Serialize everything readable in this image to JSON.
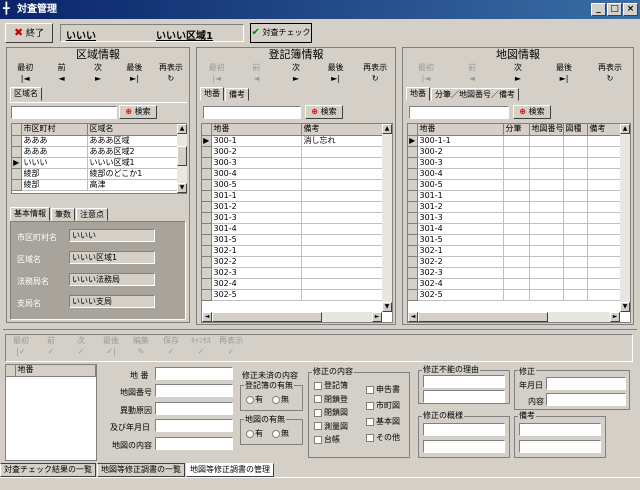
{
  "window": {
    "title": "対査管理",
    "minimize": "_",
    "maximize": "□",
    "close": "×"
  },
  "toolbar": {
    "exit_label": "終了",
    "area1": "いいい",
    "area2": "いいい区域1",
    "check_label": "対査チェック"
  },
  "nav": {
    "first": "最初",
    "prev": "前",
    "next": "次",
    "last": "最後",
    "refresh": "再表示",
    "edit": "編集",
    "save": "保存",
    "cancel": "ｷｬﾝｾﾙ"
  },
  "search": {
    "label": "検索"
  },
  "area_panel": {
    "title": "区域情報",
    "tab": "区域名",
    "columns": [
      "市区町村",
      "区域名"
    ],
    "rows": [
      [
        "あああ",
        "あああ区域"
      ],
      [
        "あああ",
        "あああ区域2"
      ],
      [
        "いいい",
        "いいい区域1"
      ],
      [
        "綾部",
        "綾部のどこか1"
      ],
      [
        "綾部",
        "高津"
      ]
    ],
    "current_row": 2,
    "info_tabs": [
      "基本情報",
      "筆数",
      "注意点"
    ],
    "info": {
      "city_label": "市区町村名",
      "city": "いいい",
      "area_label": "区域名",
      "area": "いいい区域1",
      "bureau_label": "法務局名",
      "bureau": "いいい法務局",
      "branch_label": "支局名",
      "branch": "いいい支局"
    }
  },
  "register_panel": {
    "title": "登記簿情報",
    "tabs": [
      "地番",
      "備考"
    ],
    "columns": [
      "地番",
      "備考"
    ],
    "rows": [
      [
        "300-1",
        "消し忘れ"
      ],
      [
        "300-2",
        ""
      ],
      [
        "300-3",
        ""
      ],
      [
        "300-4",
        ""
      ],
      [
        "300-5",
        ""
      ],
      [
        "301-1",
        ""
      ],
      [
        "301-2",
        ""
      ],
      [
        "301-3",
        ""
      ],
      [
        "301-4",
        ""
      ],
      [
        "301-5",
        ""
      ],
      [
        "302-1",
        ""
      ],
      [
        "302-2",
        ""
      ],
      [
        "302-3",
        ""
      ],
      [
        "302-4",
        ""
      ],
      [
        "302-5",
        ""
      ]
    ]
  },
  "map_panel": {
    "title": "地図情報",
    "tabs": [
      "地番",
      "分筆／地図番号／備考"
    ],
    "columns": [
      "地番",
      "分筆",
      "地図番号",
      "図種",
      "備考"
    ],
    "rows": [
      "300-1-1",
      "300-2",
      "300-3",
      "300-4",
      "300-5",
      "301-1",
      "301-2",
      "301-3",
      "301-4",
      "301-5",
      "302-1",
      "302-2",
      "302-3",
      "302-4",
      "302-5"
    ]
  },
  "bottom": {
    "list_header": "地番",
    "lot_label": "地 番",
    "map_no_label": "地図番号",
    "cause_label": "異動原因",
    "date_label": "及び年月日",
    "map_content_label": "地図の内容",
    "uncorrected": {
      "title": "修正未済の内容",
      "reg_title": "登記簿の有無",
      "map_title": "地図の有無",
      "yes": "有",
      "no": "無"
    },
    "correction": {
      "title": "修正の内容",
      "items": [
        "登記簿",
        "閉鎖登",
        "閉鎖図",
        "測量図",
        "台帳"
      ],
      "items2": [
        "申告書",
        "市町図",
        "基本図",
        "その他"
      ]
    },
    "impossible_title": "修正不能の理由",
    "summary_title": "修正の概様",
    "corr2": {
      "title": "修正",
      "date_label": "年月日",
      "content_label": "内容"
    },
    "memo_title": "備考"
  },
  "bottom_tabs": [
    "対査チェック結果の一覧",
    "地図等修正調書の一覧",
    "地図等修正調書の管理"
  ]
}
